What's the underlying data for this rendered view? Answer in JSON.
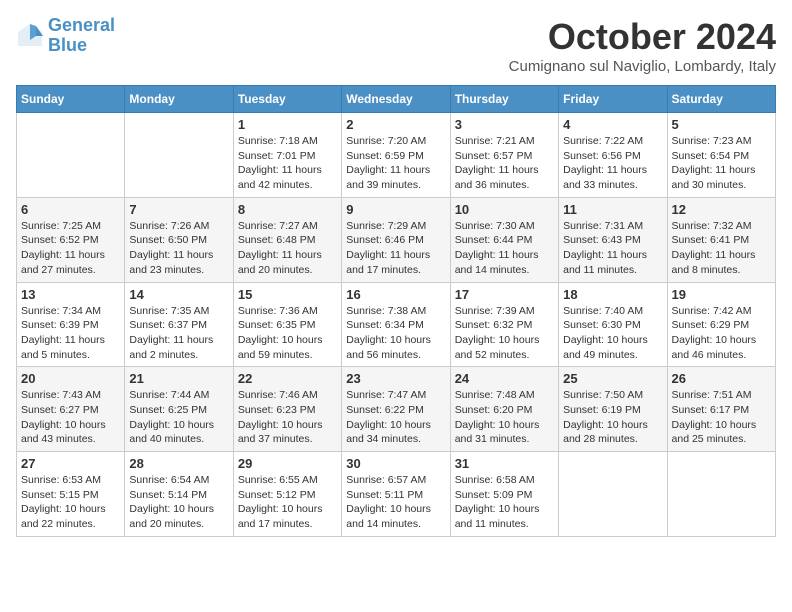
{
  "header": {
    "logo_line1": "General",
    "logo_line2": "Blue",
    "month": "October 2024",
    "location": "Cumignano sul Naviglio, Lombardy, Italy"
  },
  "weekdays": [
    "Sunday",
    "Monday",
    "Tuesday",
    "Wednesday",
    "Thursday",
    "Friday",
    "Saturday"
  ],
  "weeks": [
    [
      {
        "day": "",
        "info": ""
      },
      {
        "day": "",
        "info": ""
      },
      {
        "day": "1",
        "info": "Sunrise: 7:18 AM\nSunset: 7:01 PM\nDaylight: 11 hours and 42 minutes."
      },
      {
        "day": "2",
        "info": "Sunrise: 7:20 AM\nSunset: 6:59 PM\nDaylight: 11 hours and 39 minutes."
      },
      {
        "day": "3",
        "info": "Sunrise: 7:21 AM\nSunset: 6:57 PM\nDaylight: 11 hours and 36 minutes."
      },
      {
        "day": "4",
        "info": "Sunrise: 7:22 AM\nSunset: 6:56 PM\nDaylight: 11 hours and 33 minutes."
      },
      {
        "day": "5",
        "info": "Sunrise: 7:23 AM\nSunset: 6:54 PM\nDaylight: 11 hours and 30 minutes."
      }
    ],
    [
      {
        "day": "6",
        "info": "Sunrise: 7:25 AM\nSunset: 6:52 PM\nDaylight: 11 hours and 27 minutes."
      },
      {
        "day": "7",
        "info": "Sunrise: 7:26 AM\nSunset: 6:50 PM\nDaylight: 11 hours and 23 minutes."
      },
      {
        "day": "8",
        "info": "Sunrise: 7:27 AM\nSunset: 6:48 PM\nDaylight: 11 hours and 20 minutes."
      },
      {
        "day": "9",
        "info": "Sunrise: 7:29 AM\nSunset: 6:46 PM\nDaylight: 11 hours and 17 minutes."
      },
      {
        "day": "10",
        "info": "Sunrise: 7:30 AM\nSunset: 6:44 PM\nDaylight: 11 hours and 14 minutes."
      },
      {
        "day": "11",
        "info": "Sunrise: 7:31 AM\nSunset: 6:43 PM\nDaylight: 11 hours and 11 minutes."
      },
      {
        "day": "12",
        "info": "Sunrise: 7:32 AM\nSunset: 6:41 PM\nDaylight: 11 hours and 8 minutes."
      }
    ],
    [
      {
        "day": "13",
        "info": "Sunrise: 7:34 AM\nSunset: 6:39 PM\nDaylight: 11 hours and 5 minutes."
      },
      {
        "day": "14",
        "info": "Sunrise: 7:35 AM\nSunset: 6:37 PM\nDaylight: 11 hours and 2 minutes."
      },
      {
        "day": "15",
        "info": "Sunrise: 7:36 AM\nSunset: 6:35 PM\nDaylight: 10 hours and 59 minutes."
      },
      {
        "day": "16",
        "info": "Sunrise: 7:38 AM\nSunset: 6:34 PM\nDaylight: 10 hours and 56 minutes."
      },
      {
        "day": "17",
        "info": "Sunrise: 7:39 AM\nSunset: 6:32 PM\nDaylight: 10 hours and 52 minutes."
      },
      {
        "day": "18",
        "info": "Sunrise: 7:40 AM\nSunset: 6:30 PM\nDaylight: 10 hours and 49 minutes."
      },
      {
        "day": "19",
        "info": "Sunrise: 7:42 AM\nSunset: 6:29 PM\nDaylight: 10 hours and 46 minutes."
      }
    ],
    [
      {
        "day": "20",
        "info": "Sunrise: 7:43 AM\nSunset: 6:27 PM\nDaylight: 10 hours and 43 minutes."
      },
      {
        "day": "21",
        "info": "Sunrise: 7:44 AM\nSunset: 6:25 PM\nDaylight: 10 hours and 40 minutes."
      },
      {
        "day": "22",
        "info": "Sunrise: 7:46 AM\nSunset: 6:23 PM\nDaylight: 10 hours and 37 minutes."
      },
      {
        "day": "23",
        "info": "Sunrise: 7:47 AM\nSunset: 6:22 PM\nDaylight: 10 hours and 34 minutes."
      },
      {
        "day": "24",
        "info": "Sunrise: 7:48 AM\nSunset: 6:20 PM\nDaylight: 10 hours and 31 minutes."
      },
      {
        "day": "25",
        "info": "Sunrise: 7:50 AM\nSunset: 6:19 PM\nDaylight: 10 hours and 28 minutes."
      },
      {
        "day": "26",
        "info": "Sunrise: 7:51 AM\nSunset: 6:17 PM\nDaylight: 10 hours and 25 minutes."
      }
    ],
    [
      {
        "day": "27",
        "info": "Sunrise: 6:53 AM\nSunset: 5:15 PM\nDaylight: 10 hours and 22 minutes."
      },
      {
        "day": "28",
        "info": "Sunrise: 6:54 AM\nSunset: 5:14 PM\nDaylight: 10 hours and 20 minutes."
      },
      {
        "day": "29",
        "info": "Sunrise: 6:55 AM\nSunset: 5:12 PM\nDaylight: 10 hours and 17 minutes."
      },
      {
        "day": "30",
        "info": "Sunrise: 6:57 AM\nSunset: 5:11 PM\nDaylight: 10 hours and 14 minutes."
      },
      {
        "day": "31",
        "info": "Sunrise: 6:58 AM\nSunset: 5:09 PM\nDaylight: 10 hours and 11 minutes."
      },
      {
        "day": "",
        "info": ""
      },
      {
        "day": "",
        "info": ""
      }
    ]
  ]
}
